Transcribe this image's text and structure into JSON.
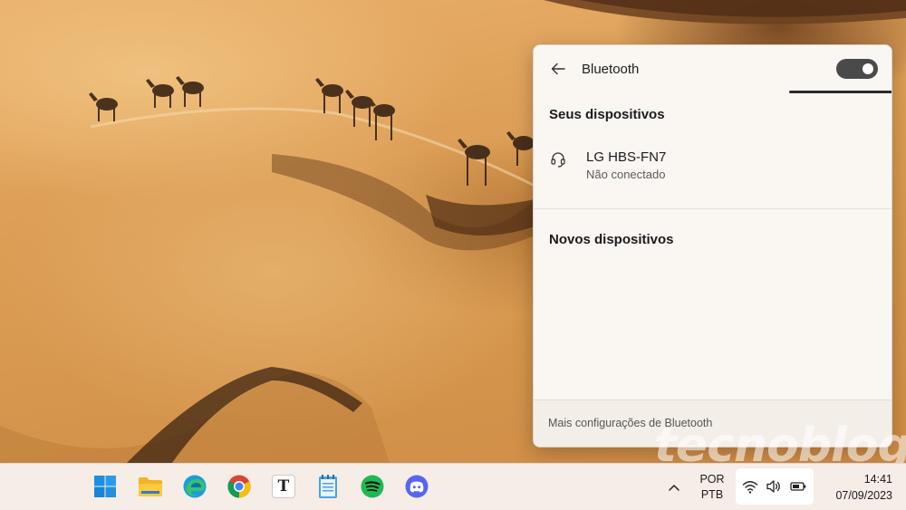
{
  "bluetooth_panel": {
    "title": "Bluetooth",
    "back_icon": "arrow-left-icon",
    "toggle_on": true,
    "my_devices": {
      "heading": "Seus dispositivos",
      "devices": [
        {
          "name": "LG HBS-FN7",
          "status": "Não conectado",
          "icon": "headset-icon"
        }
      ]
    },
    "new_devices": {
      "heading": "Novos dispositivos"
    },
    "footer_link": "Mais configurações de Bluetooth"
  },
  "watermark": "tecnoblog",
  "taskbar": {
    "apps": [
      {
        "name": "Start",
        "icon": "windows-start-icon"
      },
      {
        "name": "File Explorer",
        "icon": "folder-icon"
      },
      {
        "name": "Microsoft Edge",
        "icon": "edge-icon"
      },
      {
        "name": "Google Chrome",
        "icon": "chrome-icon"
      },
      {
        "name": "Typora",
        "icon": "typora-icon",
        "glyph": "T"
      },
      {
        "name": "Notepad",
        "icon": "notepad-icon"
      },
      {
        "name": "Spotify",
        "icon": "spotify-icon"
      },
      {
        "name": "Discord",
        "icon": "discord-icon"
      }
    ],
    "language": {
      "line1": "POR",
      "line2": "PTB"
    },
    "tray_icons": [
      "wifi-icon",
      "volume-icon",
      "battery-icon"
    ],
    "clock": {
      "time": "14:41",
      "date": "07/09/2023"
    }
  },
  "colors": {
    "panel_bg": "#faf6f2",
    "toggle_on": "#4a4a4a",
    "taskbar_bg": "#f5ede6",
    "sand": "#dc9d55"
  }
}
